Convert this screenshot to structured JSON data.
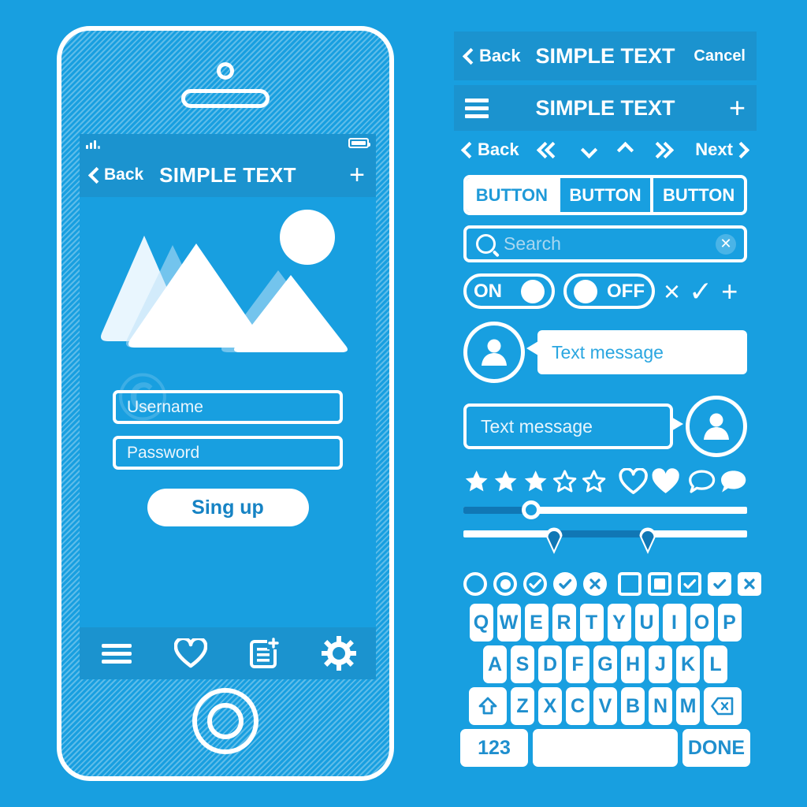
{
  "theme": {
    "background": "#189fe0",
    "bar": "#1b93cf",
    "white": "#ffffff",
    "accent_text": "#1f8fce",
    "track_dark": "#1077b5",
    "placeholder": "#a9d7f0"
  },
  "phone": {
    "camera_icon": "camera-icon",
    "speaker_icon": "speaker-icon",
    "home_button": "home-button",
    "statusbar": {
      "signal_icon": "signal-bars-icon",
      "battery_icon": "battery-icon"
    },
    "navbar": {
      "back_label": "Back",
      "title": "SIMPLE TEXT",
      "add_label": "+"
    },
    "hero": {
      "sun_icon": "sun-icon",
      "mountain_icon": "mountain-icon"
    },
    "form": {
      "username_placeholder": "Username",
      "password_placeholder": "Password",
      "signup_label": "Sing up"
    },
    "tabbar": {
      "items": [
        {
          "name": "menu-icon"
        },
        {
          "name": "heart-icon"
        },
        {
          "name": "new-document-icon"
        },
        {
          "name": "settings-gear-icon"
        }
      ]
    }
  },
  "kit": {
    "navbar_cancel": {
      "back_label": "Back",
      "title": "SIMPLE TEXT",
      "cancel_label": "Cancel"
    },
    "navbar_menu": {
      "menu_icon": "hamburger-icon",
      "title": "SIMPLE TEXT",
      "add_label": "+"
    },
    "pager": {
      "back_label": "Back",
      "next_label": "Next",
      "first_icon": "double-chevron-left-icon",
      "down_icon": "chevron-down-icon",
      "up_icon": "chevron-up-icon",
      "last_icon": "double-chevron-right-icon"
    },
    "segmented": {
      "buttons": [
        "BUTTON",
        "BUTTON",
        "BUTTON"
      ],
      "active_index": 0
    },
    "search": {
      "placeholder": "Search",
      "search_icon": "search-icon",
      "clear_icon": "clear-icon"
    },
    "toggles": {
      "on_label": "ON",
      "off_label": "OFF",
      "close_glyph": "×",
      "check_glyph": "✓",
      "plus_glyph": "+"
    },
    "messages": [
      {
        "text": "Text message",
        "style": "filled",
        "side": "left"
      },
      {
        "text": "Text message",
        "style": "outline",
        "side": "right"
      }
    ],
    "rating": {
      "stars_filled": 3,
      "stars_total": 5,
      "heart_outline_icon": "heart-outline-icon",
      "heart_filled_icon": "heart-filled-icon",
      "comment_outline_icon": "comment-outline-icon",
      "comment_filled_icon": "comment-filled-icon"
    },
    "sliders": [
      {
        "name": "single-slider",
        "value_pct": 24
      },
      {
        "name": "range-slider",
        "low_pct": 32,
        "high_pct": 65
      }
    ],
    "controls": [
      "radio-empty",
      "radio-selected",
      "circle-check-outline",
      "circle-check-filled",
      "circle-x-filled",
      "checkbox-empty",
      "checkbox-filled-inner",
      "checkbox-check-outline",
      "checkbox-check-filled",
      "checkbox-x-filled"
    ],
    "keyboard": {
      "row1": [
        "Q",
        "W",
        "E",
        "R",
        "T",
        "Y",
        "U",
        "I",
        "O",
        "P"
      ],
      "row2": [
        "A",
        "S",
        "D",
        "F",
        "G",
        "H",
        "J",
        "K",
        "L"
      ],
      "row3": [
        "Z",
        "X",
        "C",
        "V",
        "B",
        "N",
        "M"
      ],
      "shift_icon": "shift-icon",
      "backspace_icon": "backspace-icon",
      "numeric_label": "123",
      "space_label": "",
      "done_label": "DONE"
    }
  }
}
